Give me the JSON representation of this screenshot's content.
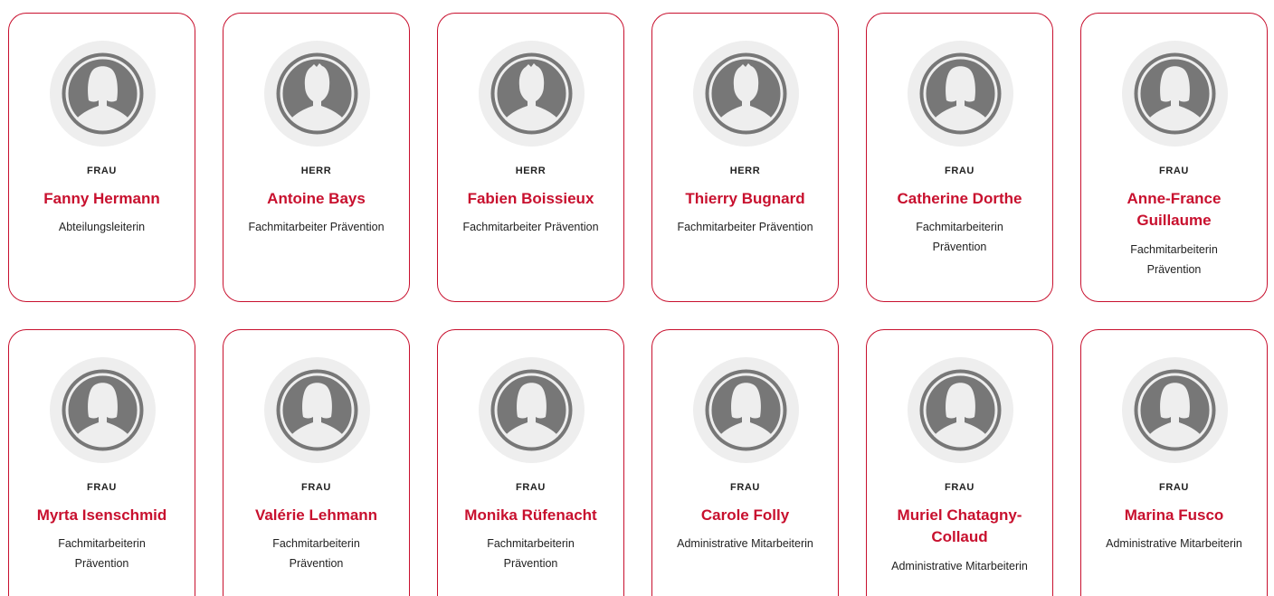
{
  "colors": {
    "accent": "#c8102e",
    "avatar_bg": "#eeeeee",
    "avatar_fg": "#777777"
  },
  "team": [
    {
      "salutation": "FRAU",
      "name": "Fanny Hermann",
      "role": "Abteilungsleiterin",
      "icon": "female-avatar-icon"
    },
    {
      "salutation": "HERR",
      "name": "Antoine Bays",
      "role": "Fachmitarbeiter Prävention",
      "icon": "male-avatar-icon"
    },
    {
      "salutation": "HERR",
      "name": "Fabien Boissieux",
      "role": "Fachmitarbeiter Prävention",
      "icon": "male-avatar-icon"
    },
    {
      "salutation": "HERR",
      "name": "Thierry Bugnard",
      "role": "Fachmitarbeiter Prävention",
      "icon": "male-avatar-icon"
    },
    {
      "salutation": "FRAU",
      "name": "Catherine Dorthe",
      "role": "Fachmitarbeiterin Prävention",
      "icon": "female-avatar-icon"
    },
    {
      "salutation": "FRAU",
      "name": "Anne-France Guillaume",
      "role": "Fachmitarbeiterin Prävention",
      "icon": "female-avatar-icon"
    },
    {
      "salutation": "FRAU",
      "name": "Myrta Isenschmid",
      "role": "Fachmitarbeiterin Prävention",
      "icon": "female-avatar-icon"
    },
    {
      "salutation": "FRAU",
      "name": "Valérie Lehmann",
      "role": "Fachmitarbeiterin Prävention",
      "icon": "female-avatar-icon"
    },
    {
      "salutation": "FRAU",
      "name": "Monika Rüfenacht",
      "role": "Fachmitarbeiterin Prävention",
      "icon": "female-avatar-icon"
    },
    {
      "salutation": "FRAU",
      "name": "Carole Folly",
      "role": "Administrative Mitarbeiterin",
      "icon": "female-avatar-icon"
    },
    {
      "salutation": "FRAU",
      "name": "Muriel Chatagny-Collaud",
      "role": "Administrative Mitarbeiterin",
      "icon": "female-avatar-icon"
    },
    {
      "salutation": "FRAU",
      "name": "Marina Fusco",
      "role": "Administrative Mitarbeiterin",
      "icon": "female-avatar-icon"
    }
  ]
}
